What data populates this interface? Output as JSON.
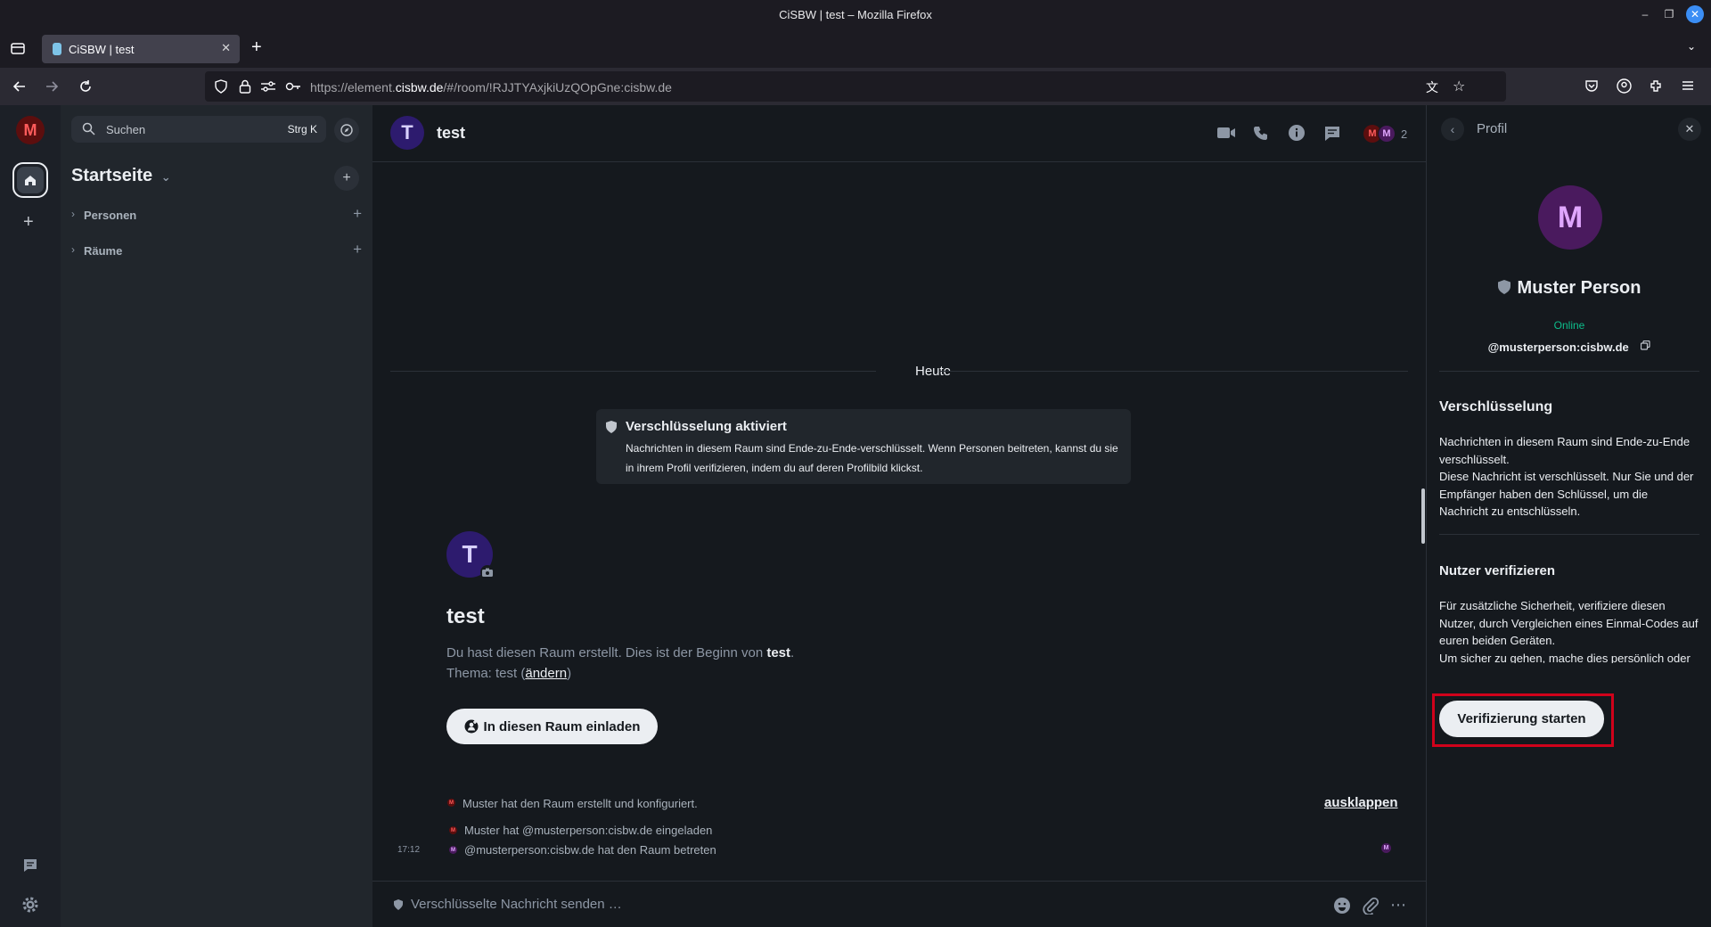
{
  "browser": {
    "window_title": "CiSBW | test – Mozilla Firefox",
    "tab_title": "CiSBW | test",
    "url_prefix": "https://element.",
    "url_domain": "cisbw.de",
    "url_suffix": "/#/room/!RJJTYAxjkiUzQOpGne:cisbw.de"
  },
  "spaces": {
    "user_initial": "M"
  },
  "roomlist": {
    "search_placeholder": "Suchen",
    "search_shortcut": "Strg K",
    "home_title": "Startseite",
    "sections": [
      {
        "label": "Personen"
      },
      {
        "label": "Räume"
      }
    ]
  },
  "room": {
    "initial": "T",
    "name": "test",
    "member_count": "2",
    "member_initials": [
      "M",
      "M"
    ],
    "date_separator": "Heute",
    "encryption_title": "Verschlüsselung aktiviert",
    "encryption_text": "Nachrichten in diesem Raum sind Ende-zu-Ende-verschlüsselt. Wenn Personen beitreten, kannst du sie in ihrem Profil verifizieren, indem du auf deren Profilbild klickst.",
    "intro_name": "test",
    "intro_text_prefix": "Du hast diesen Raum erstellt. Dies ist der Beginn von ",
    "intro_text_name": "test",
    "intro_text_suffix": ".",
    "topic_prefix": "Thema: test (",
    "topic_link": "ändern",
    "topic_suffix": ")",
    "invite_label": "In diesen Raum einladen",
    "events": [
      {
        "text": "Muster hat den Raum erstellt und konfiguriert.",
        "avatar": "M"
      },
      {
        "text": "Muster hat @musterperson:cisbw.de eingeladen",
        "avatar": "M"
      },
      {
        "text": "@musterperson:cisbw.de hat den Raum betreten",
        "avatar": "M",
        "time": "17:12"
      }
    ],
    "expand_label": "ausklappen",
    "read_receipt": "M",
    "composer_placeholder": "Verschlüsselte Nachricht senden …"
  },
  "profile": {
    "header": "Profil",
    "initial": "M",
    "name": "Muster Person",
    "status": "Online",
    "mxid": "@musterperson:cisbw.de",
    "encryption_heading": "Verschlüsselung",
    "encryption_line1": "Nachrichten in diesem Raum sind Ende-zu-Ende verschlüsselt.",
    "encryption_line2": "Diese Nachricht ist verschlüsselt. Nur Sie und der Empfänger haben den Schlüssel, um die Nachricht zu entschlüsseln.",
    "verify_heading": "Nutzer verifizieren",
    "verify_line1": "Für zusätzliche Sicherheit, verifiziere diesen Nutzer, durch Vergleichen eines Einmal-Codes auf euren beiden Geräten.",
    "verify_line2": "Um sicher zu gehen, mache dies persönlich oder verwende eine vertrauenswürdige Art der Kommunikation.",
    "verify_button": "Verifizierung starten"
  },
  "colors": {
    "accent_green": "#0dbd8b",
    "highlight_red": "#d0021b",
    "user_avatar_bg": "#5c0e0e",
    "room_avatar_bg": "#2d1b6e",
    "profile_avatar_bg": "#4a1a5e"
  }
}
